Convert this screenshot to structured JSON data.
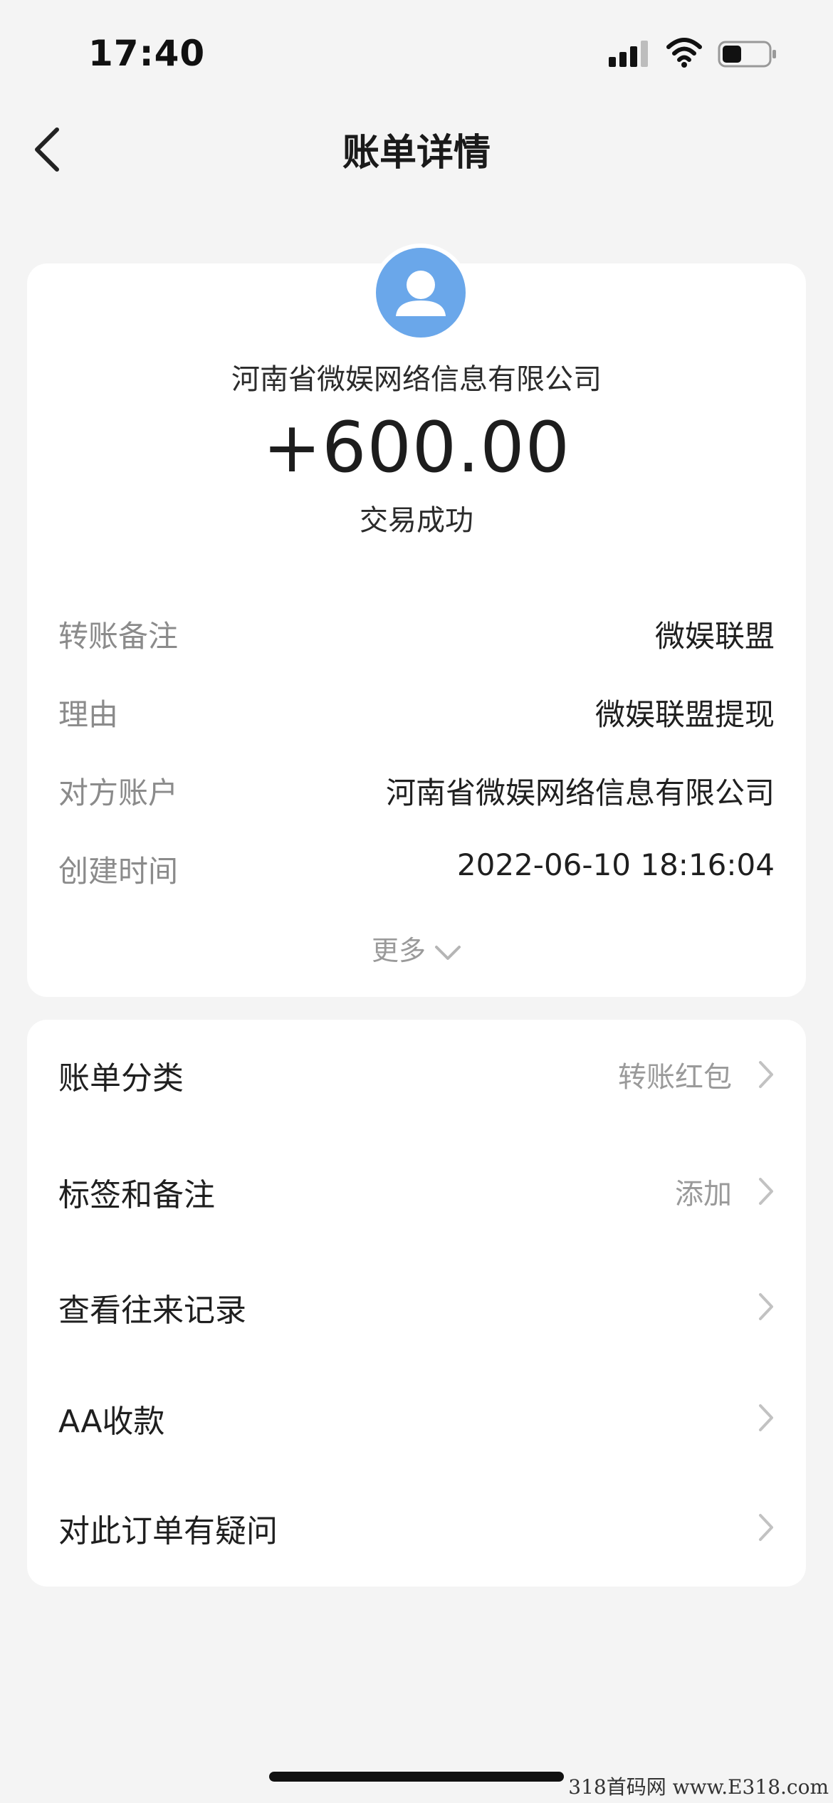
{
  "status_bar": {
    "time": "17:40",
    "icons": [
      "signal-icon",
      "wifi-icon",
      "battery-icon"
    ]
  },
  "nav": {
    "title": "账单详情",
    "back_icon": "chevron-left-icon"
  },
  "transaction": {
    "payee": "河南省微娱网络信息有限公司",
    "amount": "+600.00",
    "status": "交易成功",
    "avatar_color": "#6aa7ea"
  },
  "details": [
    {
      "label": "转账备注",
      "value": "微娱联盟"
    },
    {
      "label": "理由",
      "value": "微娱联盟提现"
    },
    {
      "label": "对方账户",
      "value": "河南省微娱网络信息有限公司"
    },
    {
      "label": "创建时间",
      "value": "2022-06-10 18:16:04"
    }
  ],
  "more": {
    "label": "更多"
  },
  "actions": [
    {
      "label": "账单分类",
      "value": "转账红包"
    },
    {
      "label": "标签和备注",
      "value": "添加"
    },
    {
      "label": "查看往来记录",
      "value": ""
    },
    {
      "label": "AA收款",
      "value": ""
    },
    {
      "label": "对此订单有疑问",
      "value": ""
    }
  ],
  "watermark": "318首码网  www.E318.com"
}
